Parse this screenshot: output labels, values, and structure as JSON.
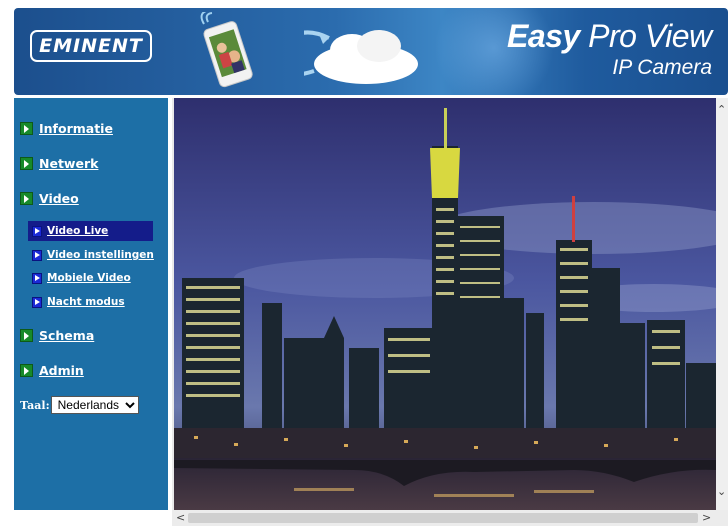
{
  "header": {
    "logo_text": "EMINENT",
    "brand_easy": "Easy",
    "brand_proview": "Pro View",
    "brand_subtitle": "IP Camera"
  },
  "sidebar": {
    "menu": [
      {
        "label": "Informatie"
      },
      {
        "label": "Netwerk"
      },
      {
        "label": "Video"
      },
      {
        "label": "Schema"
      },
      {
        "label": "Admin"
      }
    ],
    "video_submenu": [
      {
        "label": "Video Live",
        "active": true
      },
      {
        "label": "Video instellingen",
        "active": false
      },
      {
        "label": "Mobiele Video",
        "active": false
      },
      {
        "label": "Nacht modus",
        "active": false
      }
    ],
    "language_label": "Taal:",
    "language_value": "Nederlands"
  },
  "colors": {
    "sidebar_bg": "#1d6fa6",
    "active_sub_bg": "#141c8a",
    "menu_icon": "#178a2a",
    "sub_icon": "#1b2bd6"
  },
  "icons": {
    "menu_bullet": "green-play-square-icon",
    "sub_bullet": "blue-play-square-icon",
    "scroll_left": "chevron-left-icon",
    "scroll_right": "chevron-right-icon",
    "scroll_up": "chevron-up-icon",
    "scroll_down": "chevron-down-icon"
  }
}
